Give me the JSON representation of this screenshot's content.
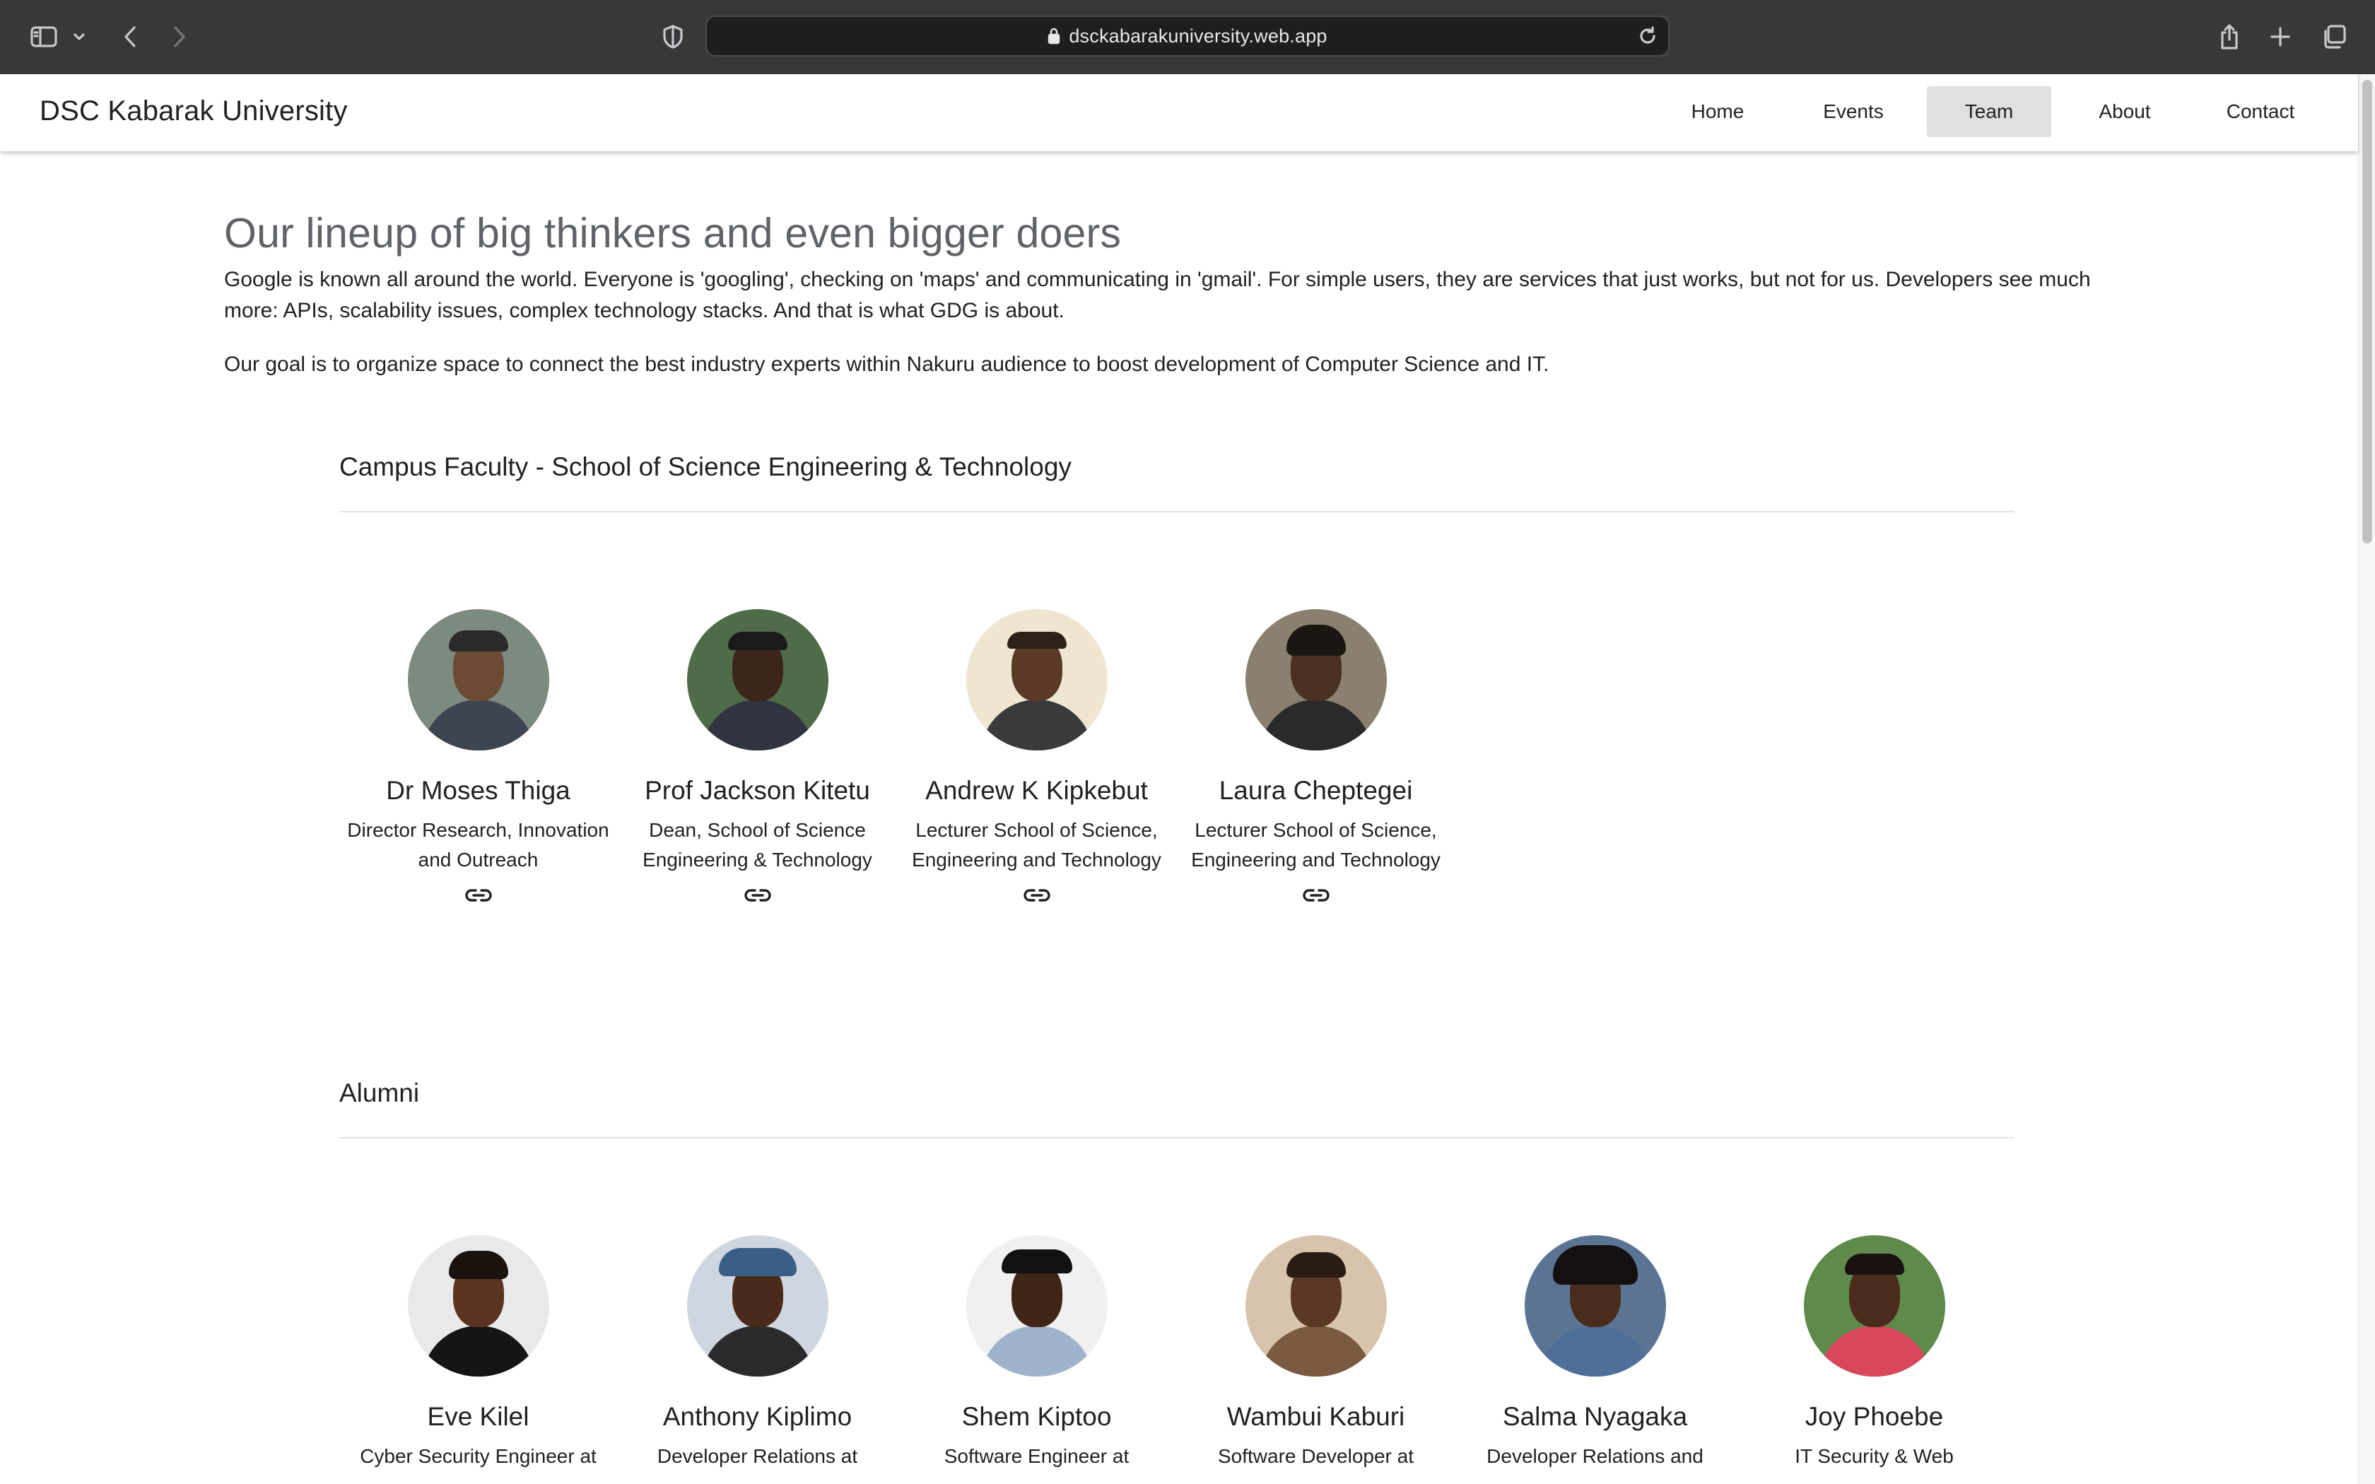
{
  "browser": {
    "url": "dsckabarakuniversity.web.app"
  },
  "header": {
    "brand": "DSC Kabarak University",
    "nav": [
      {
        "label": "Home",
        "active": false
      },
      {
        "label": "Events",
        "active": false
      },
      {
        "label": "Team",
        "active": true
      },
      {
        "label": "About",
        "active": false
      },
      {
        "label": "Contact",
        "active": false
      }
    ]
  },
  "main": {
    "headline": "Our lineup of big thinkers and even bigger doers",
    "intro": [
      "Google is known all around the world. Everyone is 'googling', checking on 'maps' and communicating in 'gmail'. For simple users, they are services that just works, but not for us. Developers see much more: APIs, scalability issues, complex technology stacks. And that is what GDG is about.",
      "Our goal is to organize space to connect the best industry experts within Nakuru audience to boost development of Computer Science and IT."
    ]
  },
  "faculty": {
    "title": "Campus Faculty - School of Science Engineering & Technology",
    "members": [
      {
        "name": "Dr Moses Thiga",
        "role": "Director Research, Innovation and Outreach",
        "icon": "link-icon"
      },
      {
        "name": "Prof Jackson Kitetu",
        "role": "Dean, School of Science Engineering & Technology",
        "icon": "link-icon"
      },
      {
        "name": "Andrew K Kipkebut",
        "role": "Lecturer School of Science, Engineering and Technology",
        "icon": "link-icon"
      },
      {
        "name": "Laura Cheptegei",
        "role": "Lecturer School of Science, Engineering and Technology",
        "icon": "link-icon"
      }
    ]
  },
  "alumni": {
    "title": "Alumni",
    "members": [
      {
        "name": "Eve Kilel",
        "role": "Cyber Security Engineer at"
      },
      {
        "name": "Anthony Kiplimo",
        "role": "Developer Relations at"
      },
      {
        "name": "Shem Kiptoo",
        "role": "Software Engineer at"
      },
      {
        "name": "Wambui Kaburi",
        "role": "Software Developer at"
      },
      {
        "name": "Salma Nyagaka",
        "role": "Developer Relations and"
      },
      {
        "name": "Joy Phoebe",
        "role": "IT Security & Web"
      }
    ]
  },
  "colors": {
    "chrome_bg": "#38383b",
    "headline": "#5f6368",
    "nav_active_bg": "#e0e0e0"
  }
}
